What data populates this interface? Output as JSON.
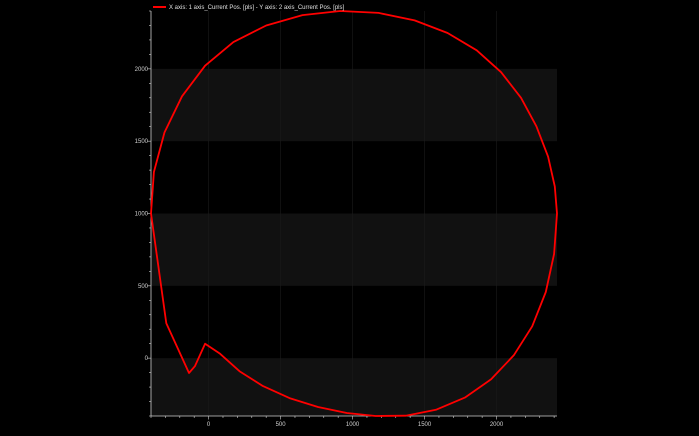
{
  "legend": {
    "label": "X axis: 1 axis_Current Pos. [pls] - Y axis: 2 axis_Current Pos. [pls]"
  },
  "colors": {
    "background": "#000000",
    "band": "#111111",
    "series": "#ff0000",
    "axis": "#cfcfcf",
    "tick_text": "#d0d0d0"
  },
  "chart_data": {
    "type": "line",
    "title": "",
    "xlabel": "",
    "ylabel": "",
    "xlim": [
      -400,
      2420
    ],
    "ylim": [
      -400,
      2400
    ],
    "x_ticks": [
      0,
      500,
      1000,
      1500,
      2000
    ],
    "y_ticks": [
      0,
      500,
      1000,
      1500,
      2000
    ],
    "grid": "alternating horizontal bands",
    "legend_position": "top-left",
    "series": [
      {
        "name": "X axis: 1 axis_Current Pos. [pls] - Y axis: 2 axis_Current Pos. [pls]",
        "color": "#ff0000",
        "x": [
          2420,
          2400,
          2342,
          2248,
          2120,
          1962,
          1780,
          1579,
          1370,
          1160,
          960,
          760,
          562,
          378,
          215,
          80,
          -24,
          -95,
          -136,
          -294,
          -400,
          -380,
          -306,
          -185,
          -24,
          172,
          400,
          652,
          915,
          1180,
          1431,
          1660,
          1862,
          2032,
          2170,
          2277,
          2358,
          2405,
          2420
        ],
        "y": [
          1000,
          721,
          457,
          220,
          20,
          -146,
          -273,
          -357,
          -398,
          -400,
          -379,
          -338,
          -276,
          -193,
          -90,
          30,
          100,
          -56,
          -103,
          241,
          1000,
          1287,
          1561,
          1810,
          2022,
          2185,
          2300,
          2372,
          2400,
          2387,
          2335,
          2248,
          2128,
          1977,
          1800,
          1603,
          1393,
          1187,
          1000
        ]
      }
    ]
  }
}
